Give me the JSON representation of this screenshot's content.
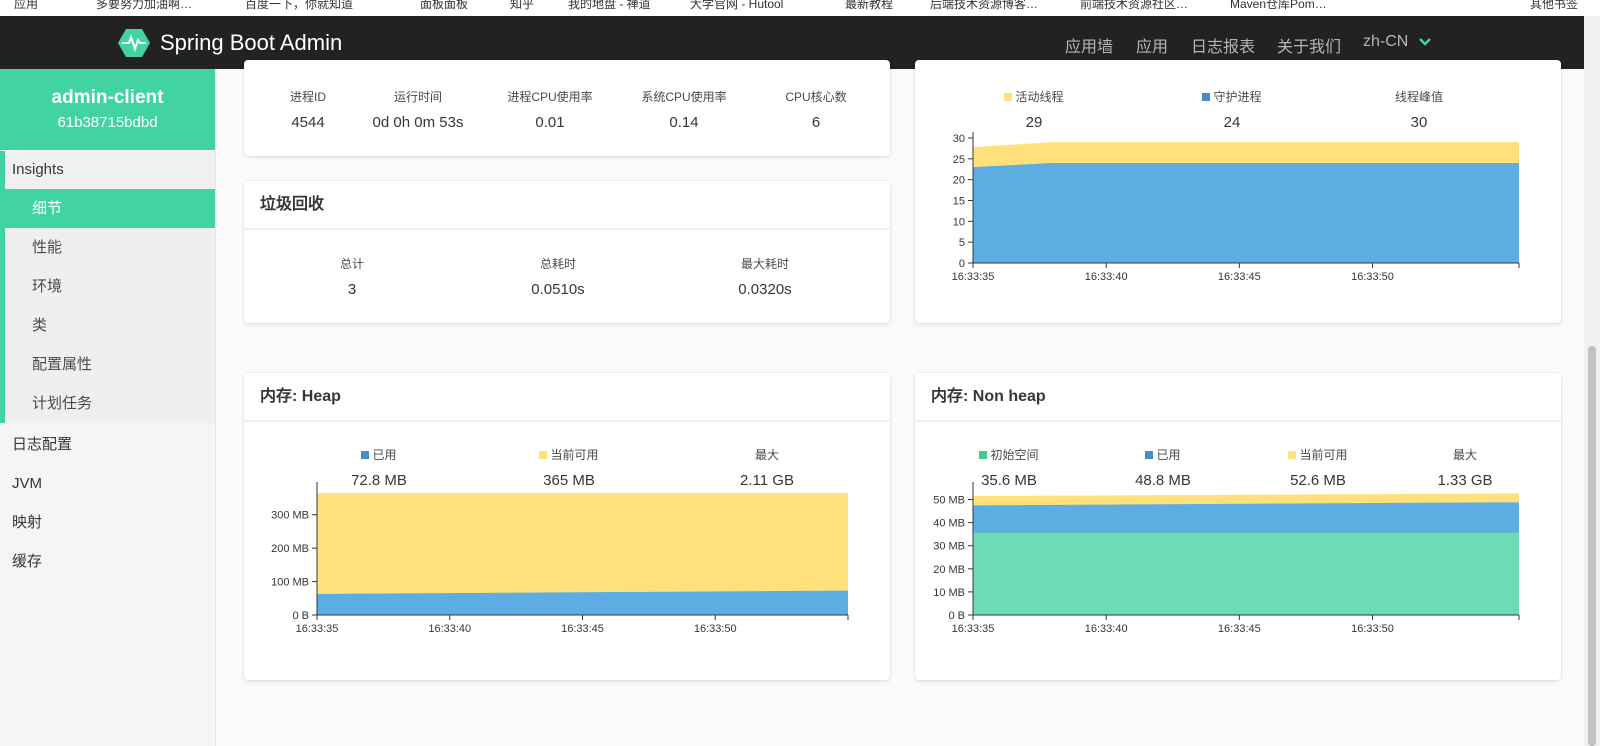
{
  "bookmarks": [
    "应用",
    "多要努力加油啊…",
    "百度一下，你就知道",
    "",
    "面板面板",
    "知乎",
    "我的地盘 - 禅道",
    "大学官网 - Hutool",
    "最新教程",
    "后端技术资源博客…",
    "前端技术资源社区…",
    "Maven仓库Pom…",
    "其他书签"
  ],
  "navbar": {
    "brand": "Spring Boot Admin",
    "items": [
      "应用墙",
      "应用",
      "日志报表",
      "关于我们"
    ],
    "language": "zh-CN"
  },
  "sidebar": {
    "app_name": "admin-client",
    "app_id": "61b38715bdbd",
    "insights_label": "Insights",
    "insights_items": [
      "细节",
      "性能",
      "环境",
      "类",
      "配置属性",
      "计划任务"
    ],
    "active_index": 0,
    "top_items": [
      "日志配置",
      "JVM",
      "映射",
      "缓存"
    ]
  },
  "process": {
    "stats": [
      {
        "label": "进程ID",
        "value": "4544"
      },
      {
        "label": "运行时间",
        "value": "0d 0h 0m 53s"
      },
      {
        "label": "进程CPU使用率",
        "value": "0.01"
      },
      {
        "label": "系统CPU使用率",
        "value": "0.14"
      },
      {
        "label": "CPU核心数",
        "value": "6"
      }
    ]
  },
  "gc": {
    "title": "垃圾回收",
    "stats": [
      {
        "label": "总计",
        "value": "3"
      },
      {
        "label": "总耗时",
        "value": "0.0510s"
      },
      {
        "label": "最大耗时",
        "value": "0.0320s"
      }
    ]
  },
  "threads": {
    "stats": [
      {
        "label": "活动线程",
        "value": "29",
        "color": "#ffe07a"
      },
      {
        "label": "守护进程",
        "value": "24",
        "color": "#3e8ed0"
      },
      {
        "label": "线程峰值",
        "value": "30"
      }
    ]
  },
  "heap": {
    "title": "内存: Heap",
    "stats": [
      {
        "label": "已用",
        "value": "72.8 MB",
        "color": "#3e8ed0"
      },
      {
        "label": "当前可用",
        "value": "365 MB",
        "color": "#ffe07a"
      },
      {
        "label": "最大",
        "value": "2.11 GB"
      }
    ]
  },
  "nonheap": {
    "title": "内存: Non heap",
    "stats": [
      {
        "label": "初始空间",
        "value": "35.6 MB",
        "color": "#48c78e"
      },
      {
        "label": "已用",
        "value": "48.8 MB",
        "color": "#3e8ed0"
      },
      {
        "label": "当前可用",
        "value": "52.6 MB",
        "color": "#ffe07a"
      },
      {
        "label": "最大",
        "value": "1.33 GB"
      }
    ]
  },
  "chart_data": [
    {
      "id": "threads",
      "type": "area",
      "x": [
        "16:33:33",
        "16:33:38",
        "16:33:53"
      ],
      "x_ticks": [
        "16:33:35",
        "16:33:40",
        "16:33:45",
        "16:33:50"
      ],
      "ylim": [
        0,
        30
      ],
      "y_ticks": [
        "0",
        "5",
        "10",
        "15",
        "20",
        "25",
        "30"
      ],
      "series": [
        {
          "name": "守护进程",
          "color": "#5dade2",
          "values": [
            23,
            24,
            24
          ]
        },
        {
          "name": "活动线程",
          "color": "#ffe07a",
          "values": [
            27.8,
            29,
            29
          ]
        }
      ]
    },
    {
      "id": "heap",
      "type": "area",
      "x": [
        "16:33:35",
        "16:33:55"
      ],
      "x_ticks": [
        "16:33:35",
        "16:33:40",
        "16:33:45",
        "16:33:50"
      ],
      "ylim": [
        0,
        380
      ],
      "y_ticks": [
        "0 B",
        "100 MB",
        "200 MB",
        "300 MB"
      ],
      "series": [
        {
          "name": "已用",
          "color": "#5dade2",
          "values": [
            63,
            73
          ]
        },
        {
          "name": "当前可用",
          "color": "#ffe07a",
          "values": [
            365,
            365
          ]
        }
      ]
    },
    {
      "id": "nonheap",
      "type": "area",
      "x": [
        "16:33:35",
        "16:33:55"
      ],
      "x_ticks": [
        "16:33:35",
        "16:33:40",
        "16:33:45",
        "16:33:50"
      ],
      "ylim": [
        0,
        55
      ],
      "y_ticks": [
        "0 B",
        "10 MB",
        "20 MB",
        "30 MB",
        "40 MB",
        "50 MB"
      ],
      "series": [
        {
          "name": "初始空间",
          "color": "#6ddbb6",
          "values": [
            35.6,
            35.6
          ]
        },
        {
          "name": "已用",
          "color": "#5dade2",
          "values": [
            47.5,
            48.8
          ]
        },
        {
          "name": "当前可用",
          "color": "#ffe07a",
          "values": [
            51.5,
            52.6
          ]
        }
      ]
    }
  ]
}
